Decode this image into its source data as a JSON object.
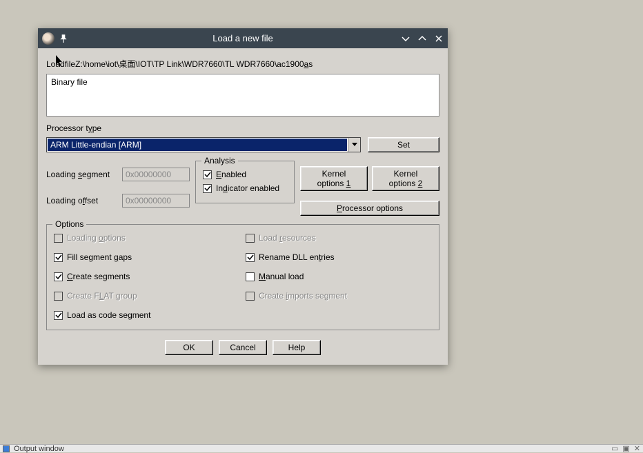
{
  "titlebar": {
    "title": "Load a new file"
  },
  "file_path": {
    "prefix_lo": "Lo",
    "prefix_a": "a",
    "prefix_d": "d",
    "word_file": " file ",
    "path": "Z:\\home\\iot\\桌面\\IOT\\TP Link\\WDR7660\\TL WDR7660\\ac1900 ",
    "as_a": "a",
    "as_s": "s"
  },
  "filetype": {
    "value": "Binary file"
  },
  "processor": {
    "label_text": "Processor t",
    "label_y": "y",
    "label_pe": "pe",
    "value": "ARM Little-endian [ARM]",
    "set_btn": "Set"
  },
  "loading": {
    "segment_label_pre": "Loading ",
    "segment_s": "s",
    "segment_label_post": "egment",
    "segment_value": "0x00000000",
    "offset_label_pre": "Loading o",
    "offset_f": "f",
    "offset_label_post": "fset",
    "offset_value": "0x00000000"
  },
  "analysis": {
    "legend": "Analysis",
    "enabled_E": "E",
    "enabled_rest": "nabled",
    "indicator_pre": "In",
    "indicator_d": "d",
    "indicator_rest": "icator enabled"
  },
  "side_btns": {
    "kernel1_pre": "Kernel options ",
    "kernel1_1": "1",
    "kernel2_pre": "Kernel options ",
    "kernel2_2": "2",
    "proc_P": "P",
    "proc_rest": "rocessor options"
  },
  "options": {
    "legend": "Options",
    "loading_options_pre": "Loading ",
    "loading_options_o": "o",
    "loading_options_rest": "ptions",
    "fill_pre": "Fill segment ",
    "fill_g": "g",
    "fill_rest": "aps",
    "create_seg_C": "C",
    "create_seg_rest": "reate segments",
    "flat_pre": "Create F",
    "flat_L": "L",
    "flat_rest": "AT group",
    "load_as_code": "Load as code segment",
    "load_res_pre": "Load ",
    "load_res_r": "r",
    "load_res_rest": "esources",
    "rename_pre": "Rename DLL en",
    "rename_t": "t",
    "rename_rest": "ries",
    "manual_M": "M",
    "manual_rest": "anual load",
    "create_imp_pre": "Create ",
    "create_imp_i": "i",
    "create_imp_rest": "mports segment"
  },
  "buttons": {
    "ok": "OK",
    "cancel": "Cancel",
    "help": "Help"
  },
  "status": {
    "output_window": "Output window"
  }
}
